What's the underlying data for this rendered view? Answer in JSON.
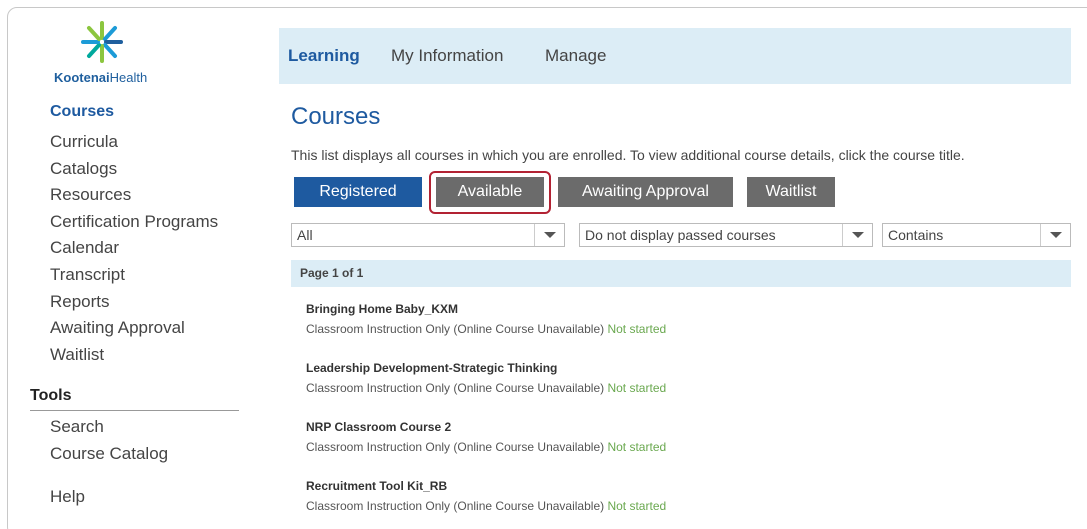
{
  "logo": {
    "brand_bold": "Kootenai",
    "brand_light": "Health"
  },
  "sidebar": {
    "heading": "Courses",
    "items": [
      {
        "label": "Curricula"
      },
      {
        "label": "Catalogs"
      },
      {
        "label": "Resources"
      },
      {
        "label": "Certification Programs"
      },
      {
        "label": "Calendar"
      },
      {
        "label": "Transcript"
      },
      {
        "label": "Reports"
      },
      {
        "label": "Awaiting Approval"
      },
      {
        "label": "Waitlist"
      }
    ],
    "tools_heading": "Tools",
    "tools": [
      {
        "label": "Search"
      },
      {
        "label": "Course Catalog"
      }
    ],
    "help": "Help"
  },
  "topnav": {
    "tabs": [
      {
        "label": "Learning"
      },
      {
        "label": "My Information"
      },
      {
        "label": "Manage"
      }
    ]
  },
  "main": {
    "title": "Courses",
    "description": "This list displays all courses in which you are enrolled. To view additional course details, click the course title.",
    "tabs": [
      {
        "label": "Registered"
      },
      {
        "label": "Available"
      },
      {
        "label": "Awaiting Approval"
      },
      {
        "label": "Waitlist"
      }
    ],
    "filters": {
      "type": "All",
      "passed": "Do not display passed courses",
      "match": "Contains"
    },
    "page_label": "Page 1 of 1",
    "courses": [
      {
        "title": "Bringing Home Baby_KXM",
        "meta": "Classroom Instruction Only (Online Course Unavailable)",
        "status": "Not started"
      },
      {
        "title": "Leadership Development-Strategic Thinking",
        "meta": "Classroom Instruction Only (Online Course Unavailable)",
        "status": "Not started"
      },
      {
        "title": "NRP Classroom Course 2",
        "meta": "Classroom Instruction Only (Online Course Unavailable)",
        "status": "Not started"
      },
      {
        "title": "Recruitment Tool Kit_RB",
        "meta": "Classroom Instruction Only (Online Course Unavailable)",
        "status": "Not started"
      }
    ]
  },
  "colors": {
    "brand_blue": "#1e5aa0",
    "tab_grey": "#6b6b6b",
    "nav_bg": "#dcedf6",
    "status_green": "#6aa84f",
    "highlight_red": "#b22233"
  }
}
